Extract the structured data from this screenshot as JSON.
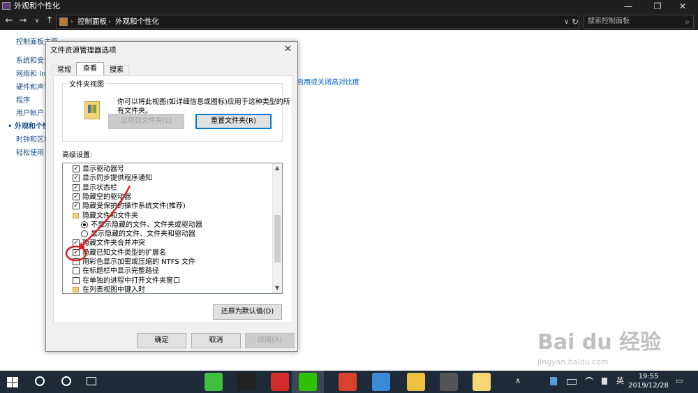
{
  "window": {
    "title": "外观和个性化",
    "min": "—",
    "max": "❐",
    "close": "✕"
  },
  "nav": {
    "back": "←",
    "forward": "→",
    "recent": "∨",
    "up": "↑",
    "sep": "›",
    "dropdown": "∨",
    "refresh": "↻"
  },
  "address": {
    "crumbs": [
      "控制面板",
      "外观和个性化"
    ]
  },
  "search": {
    "placeholder": "搜索控制面板",
    "icon": "⌕"
  },
  "sidebar": {
    "items": [
      "控制面板主页",
      "系统和安全",
      "网络和 Int",
      "硬件和声音",
      "程序",
      "用户帐户",
      "外观和个性化",
      "时钟和区域",
      "轻松使用"
    ]
  },
  "main": {
    "partial_link": "启用或关闭高对比度"
  },
  "dialog": {
    "title": "文件资源管理器选项",
    "close": "✕",
    "tabs": [
      "常规",
      "查看",
      "搜索"
    ],
    "folder_views": {
      "label": "文件夹视图",
      "desc": "你可以将此视图(如详细信息或图标)应用于这种类型的所有文件夹。",
      "apply_btn": "应用到文件夹(L)",
      "reset_btn": "重置文件夹(R)"
    },
    "advanced_label": "高级设置:",
    "advanced_items": [
      {
        "type": "checkbox",
        "checked": true,
        "label": "显示驱动器号"
      },
      {
        "type": "checkbox",
        "checked": true,
        "label": "显示同步提供程序通知"
      },
      {
        "type": "checkbox",
        "checked": true,
        "label": "显示状态栏"
      },
      {
        "type": "checkbox",
        "checked": true,
        "label": "隐藏空的驱动器"
      },
      {
        "type": "checkbox",
        "checked": true,
        "label": "隐藏受保护的操作系统文件(推荐)"
      },
      {
        "type": "folder",
        "label": "隐藏文件和文件夹"
      },
      {
        "type": "radio",
        "checked": true,
        "label": "不显示隐藏的文件、文件夹或驱动器"
      },
      {
        "type": "radio",
        "checked": false,
        "label": "显示隐藏的文件、文件夹和驱动器"
      },
      {
        "type": "checkbox",
        "checked": true,
        "label": "隐藏文件夹合并冲突"
      },
      {
        "type": "checkbox",
        "checked": true,
        "label": "隐藏已知文件类型的扩展名"
      },
      {
        "type": "checkbox",
        "checked": false,
        "label": "用彩色显示加密或压缩的 NTFS 文件"
      },
      {
        "type": "checkbox",
        "checked": false,
        "label": "在标题栏中显示完整路径"
      },
      {
        "type": "checkbox",
        "checked": false,
        "label": "在单独的进程中打开文件夹窗口"
      },
      {
        "type": "folder",
        "label": "在列表视图中键入时"
      }
    ],
    "restore_btn": "还原为默认值(D)",
    "ok_btn": "确定",
    "cancel_btn": "取消",
    "apply_btn": "应用(A)",
    "check_mark": "✓"
  },
  "taskbar": {
    "items": [
      {
        "name": "start-icon",
        "color": "#ffffff"
      },
      {
        "name": "browser-icon",
        "color": "#3fbf3f"
      },
      {
        "name": "qq-icon",
        "color": "#222222"
      },
      {
        "name": "wps-icon",
        "color": "#d42b2b"
      },
      {
        "name": "wechat-icon",
        "color": "#2dc100"
      },
      {
        "name": "power-app-icon",
        "color": "#d9412d"
      },
      {
        "name": "penguin-app-icon",
        "color": "#3a8ad6"
      },
      {
        "name": "file-explorer-icon",
        "color": "#f0c040"
      },
      {
        "name": "settings-app-icon",
        "color": "#555555"
      },
      {
        "name": "notepad-icon",
        "color": "#f5d777"
      }
    ],
    "tray": {
      "up_arrow": "∧",
      "lang": "英",
      "time": "19:55",
      "date": "2019/12/28",
      "notify": "▭"
    }
  },
  "watermark": {
    "text": "Bai du 经验",
    "url": "jingyan.baidu.com"
  }
}
